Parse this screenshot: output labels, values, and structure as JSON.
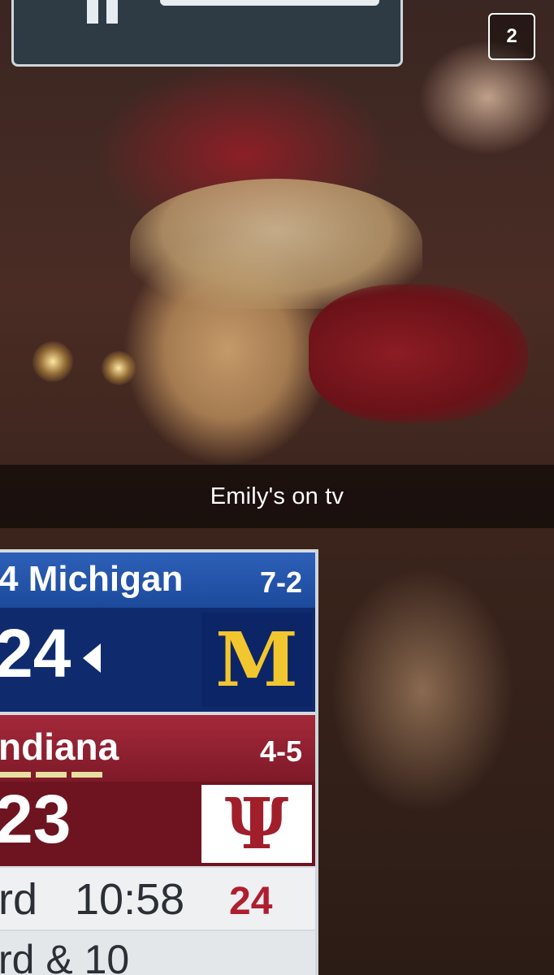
{
  "story": {
    "counter": "2",
    "caption": "Emily's on tv"
  },
  "scoreboard": {
    "team1": {
      "name": "4 Michigan",
      "record": "7-2",
      "score": "24",
      "logo_text": "M",
      "color": "#1c4a9c",
      "logo_color": "#f2c62e"
    },
    "team2": {
      "name": "ndiana",
      "record": "4-5",
      "score": "23",
      "logo_text": "Ψ",
      "color": "#7e1a28",
      "logo_color": "#a11f2b"
    },
    "game_status": {
      "quarter": "rd",
      "clock": "10:58",
      "play_clock": "24",
      "down_distance": "rd & 10"
    }
  }
}
